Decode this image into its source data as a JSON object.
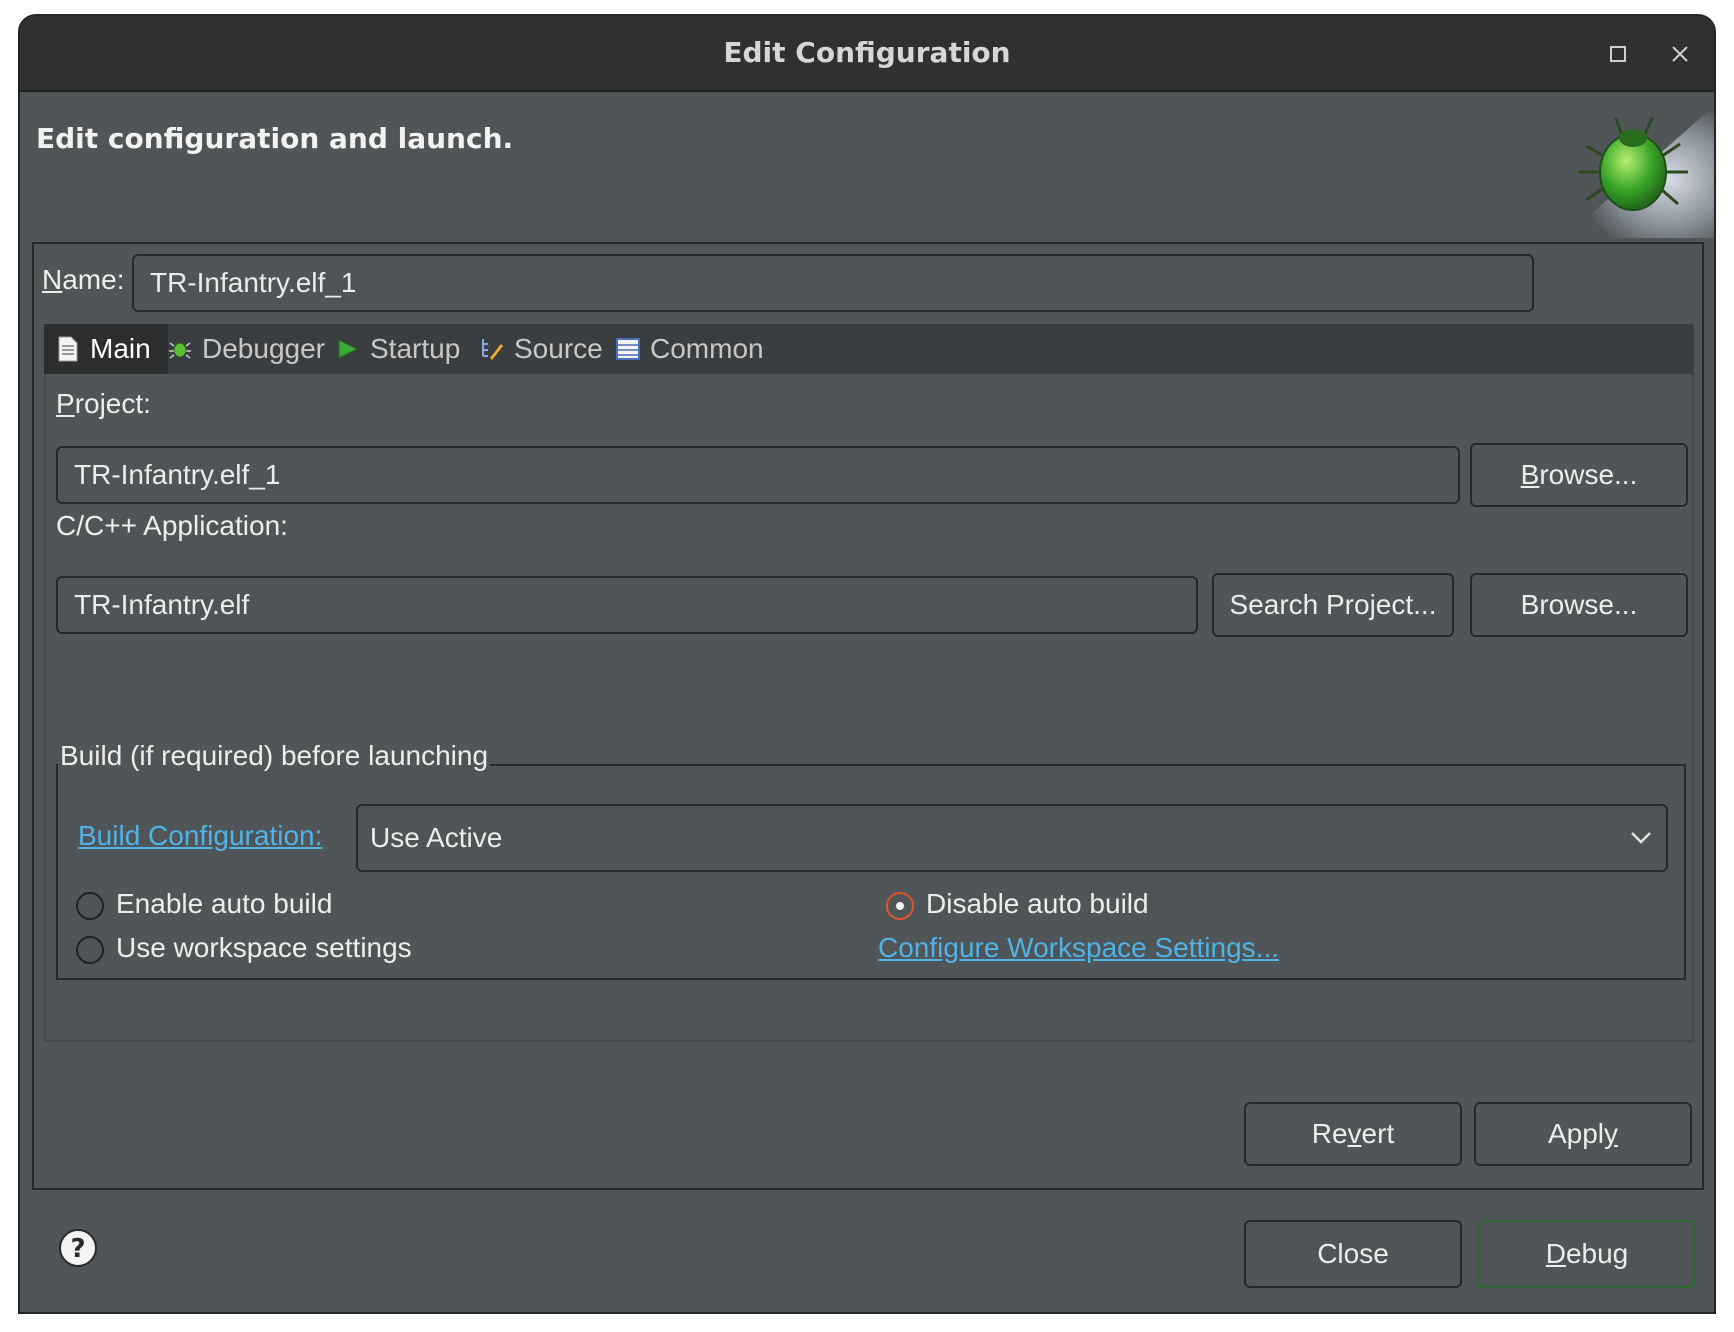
{
  "window": {
    "title": "Edit Configuration",
    "maximize_icon": "maximize-icon",
    "close_icon": "close-icon"
  },
  "banner": {
    "heading": "Edit configuration and launch.",
    "icon": "debug-beetle-icon"
  },
  "name": {
    "label_mnemonic": "N",
    "label_rest": "ame:",
    "value": "TR-Infantry.elf_1"
  },
  "tabs": [
    {
      "label": "Main",
      "icon": "main-file-icon",
      "active": true
    },
    {
      "label": "Debugger",
      "icon": "debugger-bug-icon",
      "active": false
    },
    {
      "label": "Startup",
      "icon": "startup-play-icon",
      "active": false
    },
    {
      "label": "Source",
      "icon": "source-icon",
      "active": false
    },
    {
      "label": "Common",
      "icon": "common-table-icon",
      "active": false
    }
  ],
  "main": {
    "project": {
      "label_mnemonic": "P",
      "label_rest": "roject:",
      "value": "TR-Infantry.elf_1",
      "browse_mnemonic": "B",
      "browse_rest": "rowse..."
    },
    "application": {
      "label": "C/C++ Application:",
      "value": "TR-Infantry.elf",
      "search_label": "Search Project...",
      "browse_label": "Browse..."
    },
    "build": {
      "group_title": "Build (if required) before launching",
      "config_link": "Build Configuration:",
      "config_value": "Use Active",
      "enable_auto": "Enable auto build",
      "disable_auto": "Disable auto build",
      "workspace": "Use workspace settings",
      "configure_link": "Configure Workspace Settings...",
      "selected": "Disable auto build"
    }
  },
  "panel_buttons": {
    "revert_pre": "Re",
    "revert_mnemonic": "v",
    "revert_post": "ert",
    "apply_pre": "Appl",
    "apply_mnemonic": "y"
  },
  "footer": {
    "help_icon": "help-icon",
    "close_label": "Close",
    "debug_mnemonic": "D",
    "debug_rest": "ebug"
  },
  "colors": {
    "window_bg": "#505557",
    "titlebar_bg": "#303030",
    "link": "#4fb3e8",
    "radio_selected": "#e0552a",
    "default_button_border": "#2d6a2f"
  }
}
